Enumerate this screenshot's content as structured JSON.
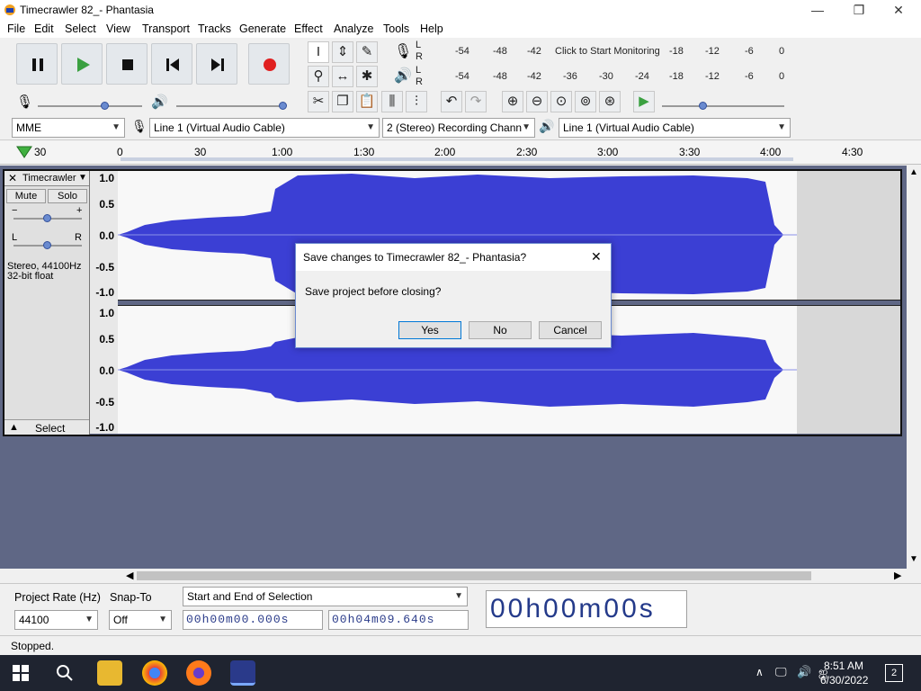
{
  "window": {
    "title": "Timecrawler 82_- Phantasia",
    "minimize": "—",
    "maximize": "❐",
    "close": "✕"
  },
  "menu": [
    "File",
    "Edit",
    "Select",
    "View",
    "Transport",
    "Tracks",
    "Generate",
    "Effect",
    "Analyze",
    "Tools",
    "Help"
  ],
  "meters": {
    "record_scale": [
      "-54",
      "-48",
      "-42",
      "Click to Start Monitoring",
      "-18",
      "-12",
      "-6",
      "0"
    ],
    "play_scale": [
      "-54",
      "-48",
      "-42",
      "-36",
      "-30",
      "-24",
      "-18",
      "-12",
      "-6",
      "0"
    ],
    "L": "L",
    "R": "R"
  },
  "device": {
    "host": "MME",
    "rec_device": "Line 1 (Virtual Audio Cable)",
    "channels": "2 (Stereo) Recording Chann",
    "play_device": "Line 1 (Virtual Audio Cable)"
  },
  "ruler": [
    "30",
    "0",
    "30",
    "1:00",
    "1:30",
    "2:00",
    "2:30",
    "3:00",
    "3:30",
    "4:00",
    "4:30"
  ],
  "track": {
    "name": "Timecrawler",
    "close": "✕",
    "mute": "Mute",
    "solo": "Solo",
    "gain_minus": "−",
    "gain_plus": "+",
    "pan_left": "L",
    "pan_right": "R",
    "info_line1": "Stereo, 44100Hz",
    "info_line2": "32-bit float",
    "select": "Select",
    "scale": [
      "1.0",
      "0.5",
      "0.0",
      "-0.5",
      "-1.0"
    ]
  },
  "dialog": {
    "title": "Save changes to Timecrawler 82_- Phantasia?",
    "message": "Save project before closing?",
    "yes": "Yes",
    "no": "No",
    "cancel": "Cancel",
    "close": "✕"
  },
  "selection": {
    "rate_label": "Project Rate (Hz)",
    "rate_value": "44100",
    "snap_label": "Snap-To",
    "snap_value": "Off",
    "mode": "Start and End of Selection",
    "start": "00h00m00.000s",
    "end": "00h04m09.640s",
    "big_time": "00h00m00s"
  },
  "status": "Stopped.",
  "tray": {
    "time": "8:51 AM",
    "date": "6/30/2022",
    "notifications": "2"
  },
  "colors": {
    "wave": "#3b3fd4",
    "track_bg": "#5f6785",
    "accent": "#2b3c8a"
  }
}
